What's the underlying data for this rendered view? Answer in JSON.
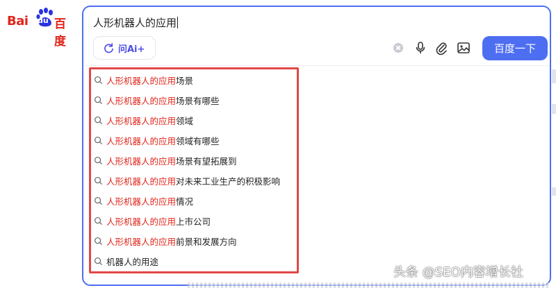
{
  "logo": {
    "bai": "Bai",
    "du": "du",
    "cn": "百度",
    "brand_color": "#e1251b"
  },
  "search": {
    "query": "人形机器人的应用",
    "ai_label": "问Ai+",
    "submit_label": "百度一下",
    "accent_color": "#4e6ef2",
    "icons": [
      "clear-icon",
      "microphone-icon",
      "paperclip-icon",
      "image-icon"
    ]
  },
  "suggestions": [
    {
      "match": "人形机器人的应用",
      "rest": "场景"
    },
    {
      "match": "人形机器人的应用",
      "rest": "场景有哪些"
    },
    {
      "match": "人形机器人的应用",
      "rest": "领域"
    },
    {
      "match": "人形机器人的应用",
      "rest": "领域有哪些"
    },
    {
      "match": "人形机器人的应用",
      "rest": "场景有望拓展到"
    },
    {
      "match": "人形机器人的应用",
      "rest": "对未来工业生产的积极影响"
    },
    {
      "match": "人形机器人的应用",
      "rest": "情况"
    },
    {
      "match": "人形机器人的应用",
      "rest": "上市公司"
    },
    {
      "match": "人形机器人的应用",
      "rest": "前景和发展方向"
    },
    {
      "match": "",
      "rest": "机器人的用途"
    }
  ],
  "highlight_color": "#e24747",
  "watermark": "头条 @SEO内容增长社"
}
